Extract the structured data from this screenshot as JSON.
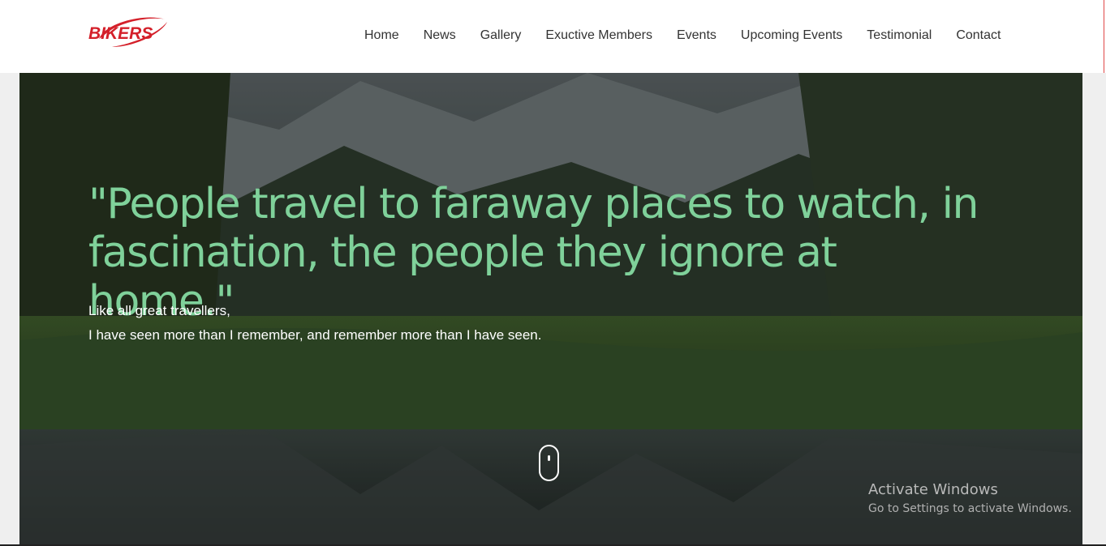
{
  "brand": {
    "logo_text": "BIKERS",
    "accent": "#d4202a"
  },
  "nav": {
    "items": [
      {
        "label": "Home"
      },
      {
        "label": "News"
      },
      {
        "label": "Gallery"
      },
      {
        "label": "Exuctive Members"
      },
      {
        "label": "Events"
      },
      {
        "label": "Upcoming Events"
      },
      {
        "label": "Testimonial"
      },
      {
        "label": "Contact"
      }
    ]
  },
  "hero": {
    "quote": "\"People travel to faraway places to watch, in fascination, the people they ignore at home.\"",
    "subtitle_line1": "Like all great travellers,",
    "subtitle_line2": "I have seen more than I remember, and remember more than I have seen.",
    "scroll_icon": "mouse-scroll-icon",
    "quote_color": "#7fd19a"
  },
  "watermark": {
    "title": "Activate Windows",
    "subtitle": "Go to Settings to activate Windows."
  }
}
